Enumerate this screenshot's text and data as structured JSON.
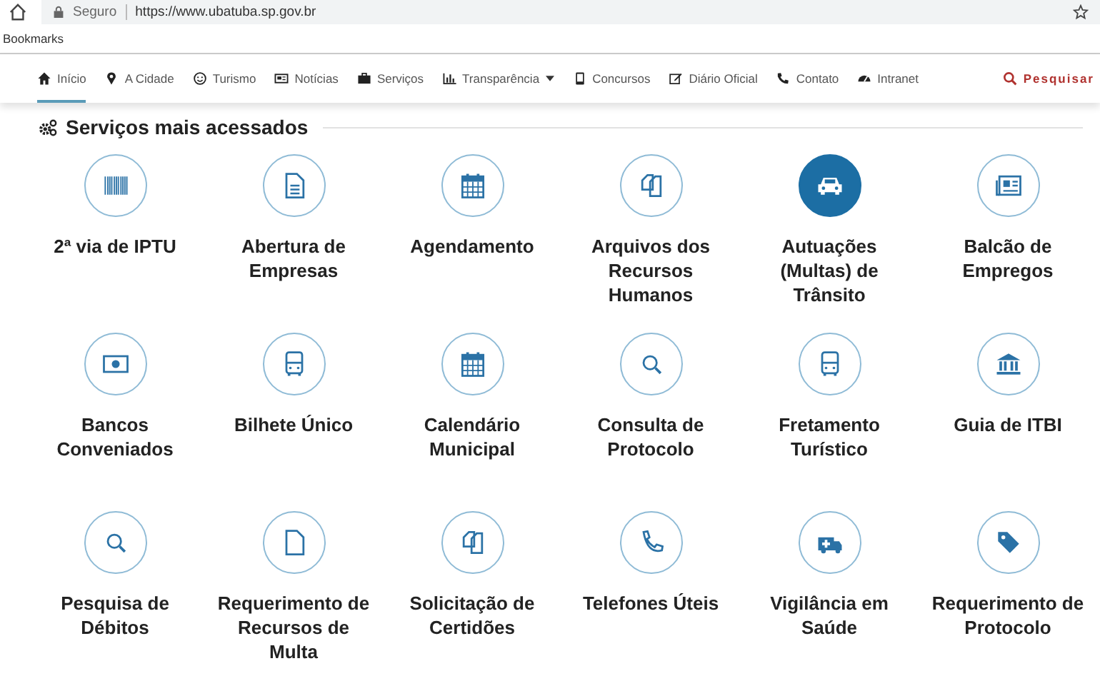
{
  "browser": {
    "security": "Seguro",
    "url": "https://www.ubatuba.sp.gov.br",
    "bookmarks": "Bookmarks"
  },
  "nav": {
    "items": [
      {
        "label": "Início",
        "selected": true
      },
      {
        "label": "A Cidade",
        "selected": false
      },
      {
        "label": "Turismo",
        "selected": false
      },
      {
        "label": "Notícias",
        "selected": false
      },
      {
        "label": "Serviços",
        "selected": false
      },
      {
        "label": "Transparência",
        "selected": false,
        "dropdown": true
      },
      {
        "label": "Concursos",
        "selected": false
      },
      {
        "label": "Diário Oficial",
        "selected": false
      },
      {
        "label": "Contato",
        "selected": false
      },
      {
        "label": "Intranet",
        "selected": false
      }
    ],
    "search": "Pesquisar"
  },
  "section": {
    "title": "Serviços mais acessados"
  },
  "services": [
    {
      "label": "2ª via de IPTU",
      "highlighted": false
    },
    {
      "label": "Abertura de Empresas",
      "highlighted": false
    },
    {
      "label": "Agendamento",
      "highlighted": false
    },
    {
      "label": "Arquivos dos Recursos Humanos",
      "highlighted": false
    },
    {
      "label": "Autuações (Multas) de Trânsito",
      "highlighted": true
    },
    {
      "label": "Balcão de Empregos",
      "highlighted": false
    },
    {
      "label": "Bancos Conveniados",
      "highlighted": false
    },
    {
      "label": "Bilhete Único",
      "highlighted": false
    },
    {
      "label": "Calendário Municipal",
      "highlighted": false
    },
    {
      "label": "Consulta de Protocolo",
      "highlighted": false
    },
    {
      "label": "Fretamento Turístico",
      "highlighted": false
    },
    {
      "label": "Guia de ITBI",
      "highlighted": false
    },
    {
      "label": "Pesquisa de Débitos",
      "highlighted": false
    },
    {
      "label": "Requerimento de Recursos de Multa",
      "highlighted": false
    },
    {
      "label": "Solicitação de Certidões",
      "highlighted": false
    },
    {
      "label": "Telefones Úteis",
      "highlighted": false
    },
    {
      "label": "Vigilância em Saúde",
      "highlighted": false
    },
    {
      "label": "Requerimento de Protocolo",
      "highlighted": false
    }
  ]
}
